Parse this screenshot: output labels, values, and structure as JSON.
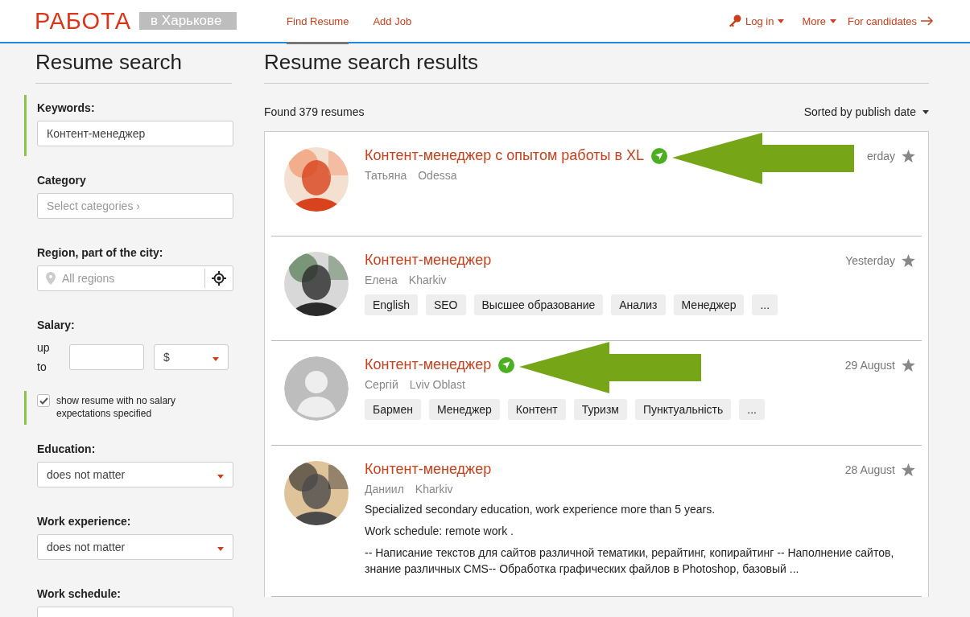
{
  "header": {
    "logo": "РАБОТА",
    "city": "в Харькове",
    "nav": [
      {
        "label": "Find Resume",
        "selected": true
      },
      {
        "label": "Add Job",
        "selected": false
      }
    ],
    "login": "Log in",
    "more": "More",
    "candidates": "For candidates"
  },
  "sidebar": {
    "title": "Resume search",
    "filters": [
      {
        "kind": "text",
        "label": "Keywords:",
        "value": "Контент-менеджер",
        "highlighted": true
      },
      {
        "kind": "picker",
        "label": "Category",
        "placeholder": "Select categories ›",
        "highlighted": false
      },
      {
        "kind": "region",
        "label": "Region, part of the city:",
        "placeholder": "All regions",
        "highlighted": false
      },
      {
        "kind": "salary",
        "label": "Salary:",
        "prefix": "up to",
        "currency": "$",
        "highlighted": false
      },
      {
        "kind": "checkbox",
        "label": "show resume with no salary expectations specified",
        "checked": true,
        "highlighted": true
      },
      {
        "kind": "select",
        "label": "Education:",
        "value": "does not matter",
        "highlighted": false
      },
      {
        "kind": "select",
        "label": "Work experience:",
        "value": "does not matter",
        "highlighted": false
      },
      {
        "kind": "select",
        "label": "Work schedule:",
        "highlighted": false
      }
    ]
  },
  "results": {
    "title": "Resume search results",
    "found": "Found 379 resumes",
    "sort": "Sorted by publish date",
    "cards": [
      {
        "title": "Контент-менеджер с опытом работы в XL",
        "verified": true,
        "arrow": true,
        "name": "Татьяна",
        "city": "Odessa",
        "date": "erday",
        "photo": true
      },
      {
        "title": "Контент-менеджер",
        "verified": false,
        "arrow": false,
        "name": "Елена",
        "city": "Kharkiv",
        "date": "Yesterday",
        "photo": true,
        "tags": [
          "English",
          "SEO",
          "Высшее образование",
          "Анализ",
          "Менеджер",
          "..."
        ]
      },
      {
        "title": "Контент-менеджер",
        "verified": true,
        "arrow": true,
        "name": "Сергій",
        "city": "Lviv Oblast",
        "date": "29 August",
        "photo": false,
        "tags": [
          "Бармен",
          "Менеджер",
          "Контент",
          "Туризм",
          "Пунктуальність",
          "..."
        ]
      },
      {
        "title": "Контент-менеджер",
        "verified": false,
        "arrow": false,
        "name": "Даниил",
        "city": "Kharkiv",
        "date": "28 August",
        "photo": true,
        "lines": [
          "Specialized secondary education, work experience more than 5 years.",
          "Work schedule: remote work .",
          "-- Написание текстов для сайтов различной тематики, рерайтинг, копирайтинг -- Наполнение сайтов, знание различных CMS-- Обработка графических файлов в Photoshop, базовый ..."
        ]
      }
    ]
  }
}
